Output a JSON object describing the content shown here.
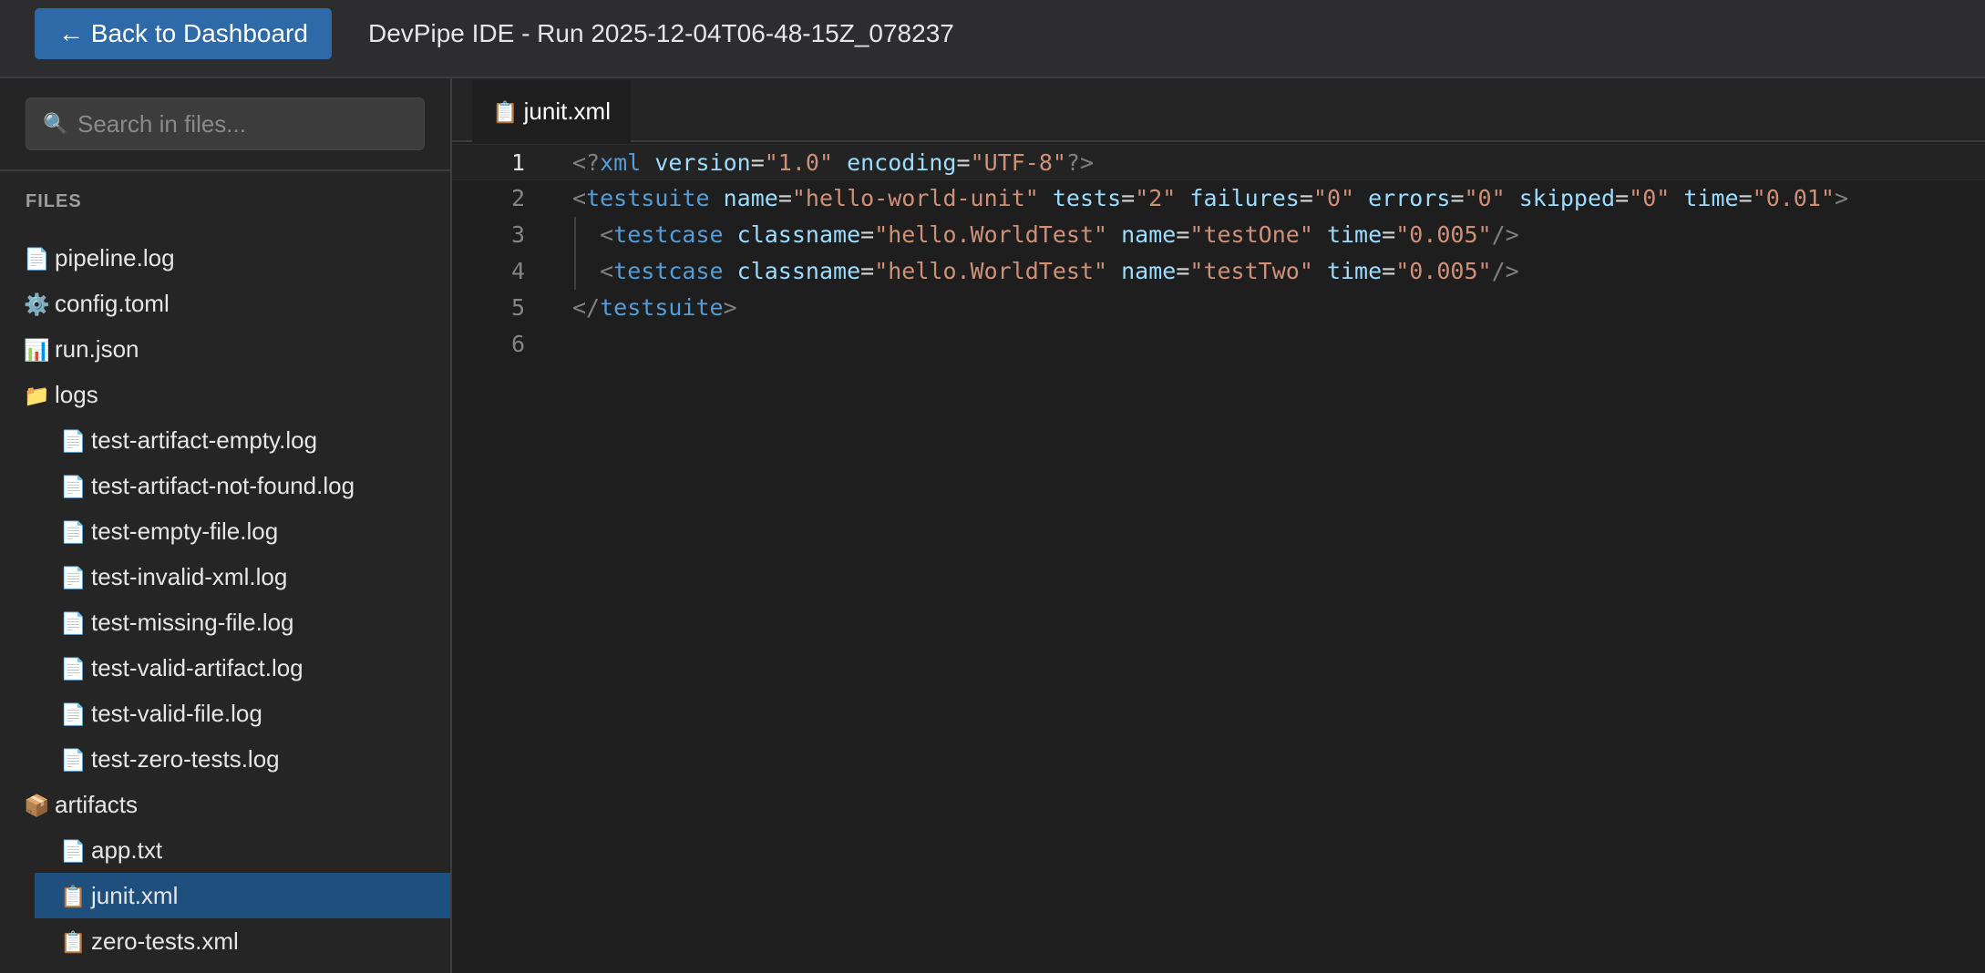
{
  "header": {
    "back_button": "← Back to Dashboard",
    "title": "DevPipe IDE - Run 2025-12-04T06-48-15Z_078237"
  },
  "sidebar": {
    "search_icon": "🔍",
    "search_placeholder": "Search in files...",
    "files_label": "FILES",
    "items": [
      {
        "icon": "📄",
        "label": "pipeline.log"
      },
      {
        "icon": "⚙️",
        "label": "config.toml"
      },
      {
        "icon": "📊",
        "label": "run.json"
      },
      {
        "icon": "📁",
        "label": "logs"
      },
      {
        "icon": "📄",
        "label": "test-artifact-empty.log"
      },
      {
        "icon": "📄",
        "label": "test-artifact-not-found.log"
      },
      {
        "icon": "📄",
        "label": "test-empty-file.log"
      },
      {
        "icon": "📄",
        "label": "test-invalid-xml.log"
      },
      {
        "icon": "📄",
        "label": "test-missing-file.log"
      },
      {
        "icon": "📄",
        "label": "test-valid-artifact.log"
      },
      {
        "icon": "📄",
        "label": "test-valid-file.log"
      },
      {
        "icon": "📄",
        "label": "test-zero-tests.log"
      },
      {
        "icon": "📦",
        "label": "artifacts"
      },
      {
        "icon": "📄",
        "label": "app.txt"
      },
      {
        "icon": "📋",
        "label": "junit.xml"
      },
      {
        "icon": "📋",
        "label": "zero-tests.xml"
      }
    ]
  },
  "editor": {
    "tab": {
      "icon": "📋",
      "label": "junit.xml"
    },
    "line_numbers": [
      "1",
      "2",
      "3",
      "4",
      "5",
      "6"
    ],
    "lines": [
      [
        {
          "c": "p",
          "t": "<?"
        },
        {
          "c": "t",
          "t": "xml"
        },
        {
          "c": "eq",
          "t": " "
        },
        {
          "c": "a",
          "t": "version"
        },
        {
          "c": "eq",
          "t": "="
        },
        {
          "c": "s",
          "t": "\"1.0\""
        },
        {
          "c": "eq",
          "t": " "
        },
        {
          "c": "a",
          "t": "encoding"
        },
        {
          "c": "eq",
          "t": "="
        },
        {
          "c": "s",
          "t": "\"UTF-8\""
        },
        {
          "c": "p",
          "t": "?>"
        }
      ],
      [
        {
          "c": "p",
          "t": "<"
        },
        {
          "c": "t",
          "t": "testsuite"
        },
        {
          "c": "eq",
          "t": " "
        },
        {
          "c": "a",
          "t": "name"
        },
        {
          "c": "eq",
          "t": "="
        },
        {
          "c": "s",
          "t": "\"hello-world-unit\""
        },
        {
          "c": "eq",
          "t": " "
        },
        {
          "c": "a",
          "t": "tests"
        },
        {
          "c": "eq",
          "t": "="
        },
        {
          "c": "s",
          "t": "\"2\""
        },
        {
          "c": "eq",
          "t": " "
        },
        {
          "c": "a",
          "t": "failures"
        },
        {
          "c": "eq",
          "t": "="
        },
        {
          "c": "s",
          "t": "\"0\""
        },
        {
          "c": "eq",
          "t": " "
        },
        {
          "c": "a",
          "t": "errors"
        },
        {
          "c": "eq",
          "t": "="
        },
        {
          "c": "s",
          "t": "\"0\""
        },
        {
          "c": "eq",
          "t": " "
        },
        {
          "c": "a",
          "t": "skipped"
        },
        {
          "c": "eq",
          "t": "="
        },
        {
          "c": "s",
          "t": "\"0\""
        },
        {
          "c": "eq",
          "t": " "
        },
        {
          "c": "a",
          "t": "time"
        },
        {
          "c": "eq",
          "t": "="
        },
        {
          "c": "s",
          "t": "\"0.01\""
        },
        {
          "c": "p",
          "t": ">"
        }
      ],
      [
        {
          "c": "eq",
          "t": "  "
        },
        {
          "c": "p",
          "t": "<"
        },
        {
          "c": "t",
          "t": "testcase"
        },
        {
          "c": "eq",
          "t": " "
        },
        {
          "c": "a",
          "t": "classname"
        },
        {
          "c": "eq",
          "t": "="
        },
        {
          "c": "s",
          "t": "\"hello.WorldTest\""
        },
        {
          "c": "eq",
          "t": " "
        },
        {
          "c": "a",
          "t": "name"
        },
        {
          "c": "eq",
          "t": "="
        },
        {
          "c": "s",
          "t": "\"testOne\""
        },
        {
          "c": "eq",
          "t": " "
        },
        {
          "c": "a",
          "t": "time"
        },
        {
          "c": "eq",
          "t": "="
        },
        {
          "c": "s",
          "t": "\"0.005\""
        },
        {
          "c": "p",
          "t": "/>"
        }
      ],
      [
        {
          "c": "eq",
          "t": "  "
        },
        {
          "c": "p",
          "t": "<"
        },
        {
          "c": "t",
          "t": "testcase"
        },
        {
          "c": "eq",
          "t": " "
        },
        {
          "c": "a",
          "t": "classname"
        },
        {
          "c": "eq",
          "t": "="
        },
        {
          "c": "s",
          "t": "\"hello.WorldTest\""
        },
        {
          "c": "eq",
          "t": " "
        },
        {
          "c": "a",
          "t": "name"
        },
        {
          "c": "eq",
          "t": "="
        },
        {
          "c": "s",
          "t": "\"testTwo\""
        },
        {
          "c": "eq",
          "t": " "
        },
        {
          "c": "a",
          "t": "time"
        },
        {
          "c": "eq",
          "t": "="
        },
        {
          "c": "s",
          "t": "\"0.005\""
        },
        {
          "c": "p",
          "t": "/>"
        }
      ],
      [
        {
          "c": "p",
          "t": "</"
        },
        {
          "c": "t",
          "t": "testsuite"
        },
        {
          "c": "p",
          "t": ">"
        }
      ],
      []
    ]
  },
  "colors": {
    "accent_button": "#2f6aa8",
    "active_file_bg": "#1f4f7d",
    "xml_tag": "#569cd6",
    "xml_attr": "#9cdcfe",
    "xml_string": "#ce9178"
  }
}
